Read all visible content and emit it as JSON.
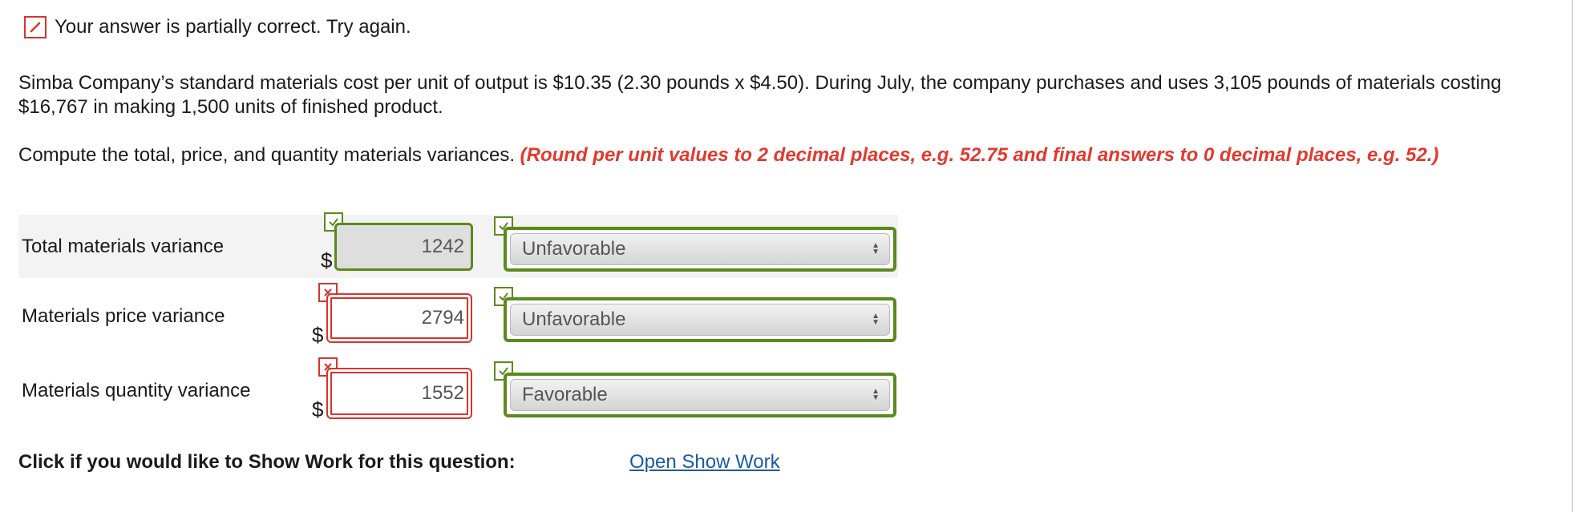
{
  "feedback": {
    "message": "Your answer is partially correct.  Try again.",
    "icon": "pencil-icon",
    "color": "#d6342c"
  },
  "problem": {
    "text": "Simba Company’s standard materials cost per unit of output is $10.35 (2.30 pounds x $4.50). During July, the company purchases and uses 3,105 pounds of materials costing $16,767 in making 1,500 units of finished product.",
    "prompt": "Compute the total, price, and quantity materials variances.",
    "instruction": "(Round per unit values to 2 decimal places, e.g. 52.75 and final answers to 0 decimal places, e.g. 52.)"
  },
  "rows": [
    {
      "label": "Total materials variance",
      "currency": "$",
      "value": "1242",
      "value_status": "correct",
      "select_value": "Unfavorable",
      "select_status": "correct"
    },
    {
      "label": "Materials price variance",
      "currency": "$",
      "value": "2794",
      "value_status": "incorrect",
      "select_value": "Unfavorable",
      "select_status": "correct"
    },
    {
      "label": "Materials quantity variance",
      "currency": "$",
      "value": "1552",
      "value_status": "incorrect",
      "select_value": "Favorable",
      "select_status": "correct"
    }
  ],
  "footer": {
    "prompt": "Click if you would like to Show Work for this question:",
    "link": "Open Show Work"
  },
  "colors": {
    "correct": "#5a8a1c",
    "incorrect": "#d6342c",
    "link": "#1a5aa0",
    "instruction": "#e03a2e"
  }
}
